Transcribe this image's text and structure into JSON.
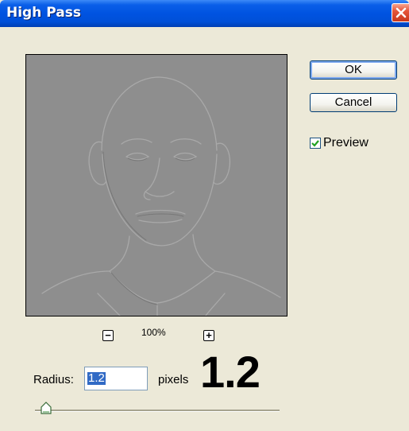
{
  "window": {
    "title": "High Pass"
  },
  "buttons": {
    "ok_label": "OK",
    "cancel_label": "Cancel"
  },
  "preview_checkbox": {
    "label": "Preview",
    "checked": true
  },
  "zoom": {
    "level": "100%",
    "zoom_out_glyph": "−",
    "zoom_in_glyph": "+"
  },
  "radius": {
    "label": "Radius:",
    "value": "1.2",
    "unit": "pixels",
    "callout": "1.2"
  },
  "slider": {
    "value": 1.2
  },
  "colors": {
    "titlebar": "#0053e1",
    "dialog_background": "#ece9d8",
    "selection": "#316ac5",
    "check_mark": "#21a121",
    "preview_gray": "#8e8e8e"
  },
  "icons": {
    "close": "close-icon",
    "zoom_out": "minus-icon",
    "zoom_in": "plus-icon",
    "check": "checkmark-icon",
    "slider_thumb": "slider-thumb-icon"
  }
}
